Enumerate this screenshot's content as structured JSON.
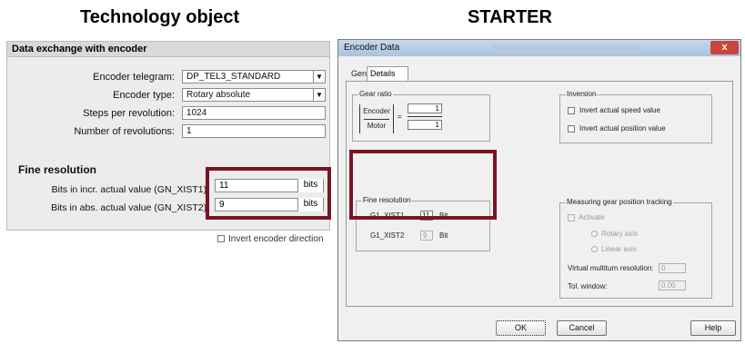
{
  "headings": {
    "left": "Technology object",
    "right": "STARTER"
  },
  "left_panel": {
    "title": "Data exchange with encoder",
    "rows": [
      {
        "label": "Encoder telegram:",
        "value": "DP_TEL3_STANDARD"
      },
      {
        "label": "Encoder type:",
        "value": "Rotary absolute"
      },
      {
        "label": "Steps per revolution:",
        "value": "1024"
      },
      {
        "label": "Number of revolutions:",
        "value": "1"
      }
    ],
    "fine_resolution": {
      "title": "Fine resolution",
      "rows": [
        {
          "label": "Bits in incr. actual value (GN_XIST1):",
          "value": "11",
          "unit": "bits"
        },
        {
          "label": "Bits in abs. actual value (GN_XIST2):",
          "value": "9",
          "unit": "bits"
        }
      ]
    },
    "invert_label": "Invert encoder direction",
    "dropdown_glyph": "▼"
  },
  "dialog": {
    "title": "Encoder Data",
    "close_glyph": "x",
    "tabs": [
      "General",
      "Details"
    ],
    "gear_ratio": {
      "title": "Gear ratio",
      "numerator": "Encoder",
      "denominator": "Motor",
      "equals": "=",
      "value_top": "1",
      "value_bottom": "1"
    },
    "inversion": {
      "title": "Inversion",
      "invert_speed": "Invert actual speed value",
      "invert_position": "Invert actual position value"
    },
    "fine_resolution": {
      "title": "Fine resolution",
      "xist1_label": "G1_XIST1",
      "xist1_value": "11",
      "xist1_unit": "Bit",
      "xist2_label": "G1_XIST2",
      "xist2_value": "9",
      "xist2_unit": "Bit"
    },
    "gear_tracking": {
      "title": "Measuring gear position tracking",
      "activate": "Activate",
      "rotary": "Rotary axis",
      "linear": "Linear axis",
      "multiturn_label": "Virtual multiturn resolution:",
      "multiturn_value": "0",
      "tol_label": "Tol. window:",
      "tol_value": "0.00"
    },
    "buttons": {
      "ok": "OK",
      "cancel": "Cancel",
      "help": "Help"
    }
  },
  "colors": {
    "highlight": "#7a1424"
  }
}
